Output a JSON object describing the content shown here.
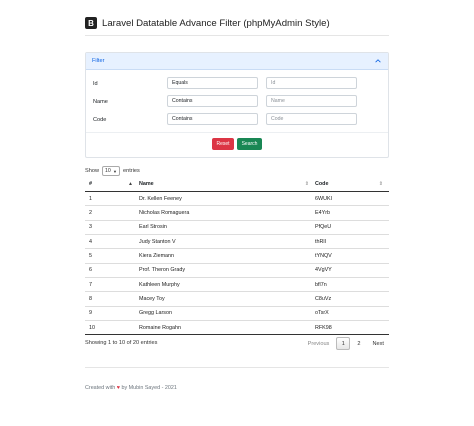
{
  "header": {
    "logo_letter": "B",
    "title": "Laravel Datatable Advance Filter (phpMyAdmin Style)"
  },
  "filter": {
    "title": "Filter",
    "rows": [
      {
        "label": "Id",
        "operator": "Equals",
        "placeholder": "Id"
      },
      {
        "label": "Name",
        "operator": "Contains",
        "placeholder": "Name"
      },
      {
        "label": "Code",
        "operator": "Contains",
        "placeholder": "Code"
      }
    ],
    "reset_label": "Reset",
    "search_label": "Search"
  },
  "length": {
    "show_label": "Show",
    "value": "10",
    "entries_label": "entries"
  },
  "table": {
    "columns": [
      "#",
      "Name",
      "Code"
    ],
    "rows": [
      [
        "1",
        "Dr. Kellen Feeney",
        "6WUKI"
      ],
      [
        "2",
        "Nicholas Romaguera",
        "E4Yrb"
      ],
      [
        "3",
        "Earl Strosin",
        "PfQeU"
      ],
      [
        "4",
        "Judy Stanton V",
        "thRlI"
      ],
      [
        "5",
        "Kiera Ziemann",
        "tYNQV"
      ],
      [
        "6",
        "Prof. Theron Grady",
        "4VgVY"
      ],
      [
        "7",
        "Kathleen Murphy",
        "bfl7n"
      ],
      [
        "8",
        "Macey Toy",
        "C8uVz"
      ],
      [
        "9",
        "Gregg Larson",
        "oTsrX"
      ],
      [
        "10",
        "Romaine Rogahn",
        "RFK98"
      ]
    ]
  },
  "info": "Showing 1 to 10 of 20 entries",
  "pagination": {
    "previous": "Previous",
    "pages": [
      "1",
      "2"
    ],
    "current": "1",
    "next": "Next"
  },
  "footer": {
    "prefix": "Created with",
    "suffix": "by Mubin Sayed - 2021"
  },
  "colors": {
    "reset": "#dc3545",
    "search": "#198754",
    "filter_header": "#e7f1ff",
    "heart": "#dc3545"
  }
}
